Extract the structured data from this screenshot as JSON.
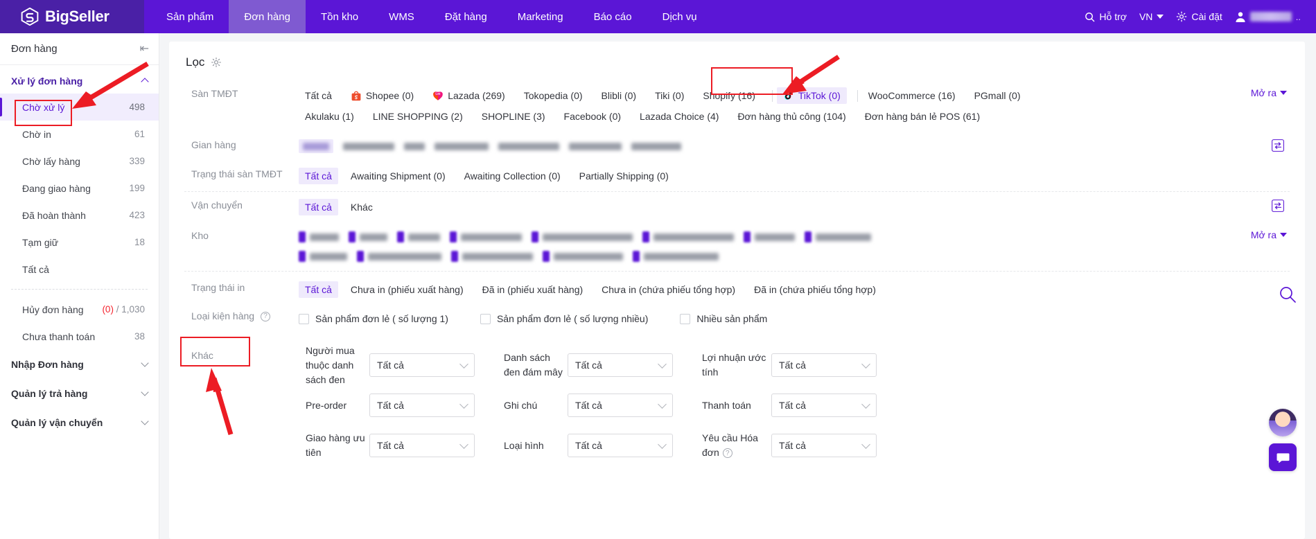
{
  "topnav": {
    "brand": "BigSeller",
    "brand_logo_icon": "bigseller-logo-icon",
    "items": [
      {
        "label": "Sản phẩm",
        "active": false
      },
      {
        "label": "Đơn hàng",
        "active": true
      },
      {
        "label": "Tồn kho",
        "active": false
      },
      {
        "label": "WMS",
        "active": false
      },
      {
        "label": "Đặt hàng",
        "active": false
      },
      {
        "label": "Marketing",
        "active": false
      },
      {
        "label": "Báo cáo",
        "active": false
      },
      {
        "label": "Dịch vụ",
        "active": false
      }
    ],
    "support": "Hỗ trợ",
    "support_icon": "search-icon",
    "language": "VN",
    "settings": "Cài đặt",
    "settings_icon": "gear-icon",
    "user_icon": "user-avatar-icon",
    "user_name_masked": ""
  },
  "sidebar": {
    "title": "Đơn hàng",
    "collapse_icon": "collapse-panel-icon",
    "group1": {
      "label": "Xử lý đơn hàng",
      "items": [
        {
          "label": "Chờ xử lý",
          "count": "498",
          "selected": true
        },
        {
          "label": "Chờ in",
          "count": "61",
          "selected": false
        },
        {
          "label": "Chờ lấy hàng",
          "count": "339",
          "selected": false
        },
        {
          "label": "Đang giao hàng",
          "count": "199",
          "selected": false
        },
        {
          "label": "Đã hoàn thành",
          "count": "423",
          "selected": false
        },
        {
          "label": "Tạm giữ",
          "count": "18",
          "selected": false
        },
        {
          "label": "Tất cả",
          "count": "",
          "selected": false
        }
      ],
      "items2": [
        {
          "label": "Hủy đơn hàng",
          "count_zero": "(0)",
          "count_rest": "/ 1,030"
        },
        {
          "label": "Chưa thanh toán",
          "count": "38"
        }
      ]
    },
    "groups": [
      {
        "label": "Nhập Đơn hàng"
      },
      {
        "label": "Quản lý trả hàng"
      },
      {
        "label": "Quản lý vận chuyển"
      }
    ]
  },
  "filter": {
    "title": "Lọc",
    "gear_icon": "gear-icon",
    "more_label": "Mở ra",
    "swap_icon": "swap-expand-icon",
    "rows": {
      "platform": {
        "label": "Sàn TMĐT",
        "line1": [
          {
            "label": "Tất cả",
            "icon": "",
            "state": "normal"
          },
          {
            "label": "Shopee (0)",
            "icon": "shopee-icon",
            "state": "normal"
          },
          {
            "label": "Lazada (269)",
            "icon": "lazada-icon",
            "state": "normal"
          },
          {
            "label": "Tokopedia (0)",
            "icon": "",
            "state": "normal"
          },
          {
            "label": "Blibli (0)",
            "icon": "",
            "state": "normal"
          },
          {
            "label": "Tiki (0)",
            "icon": "",
            "state": "normal"
          },
          {
            "label": "Shopify (16)",
            "icon": "",
            "state": "normal"
          },
          {
            "label": "TikTok (0)",
            "icon": "tiktok-icon",
            "state": "highlighted"
          },
          {
            "label": "WooCommerce (16)",
            "icon": "",
            "state": "normal"
          },
          {
            "label": "PGmall (0)",
            "icon": "",
            "state": "normal"
          }
        ],
        "line2": [
          {
            "label": "Akulaku (1)"
          },
          {
            "label": "LINE SHOPPING (2)"
          },
          {
            "label": "SHOPLINE (3)"
          },
          {
            "label": "Facebook (0)"
          },
          {
            "label": "Lazada Choice (4)"
          },
          {
            "label": "Đơn hàng thủ công (104)"
          },
          {
            "label": "Đơn hàng bán lẻ POS (61)"
          }
        ]
      },
      "shop": {
        "label": "Gian hàng",
        "masked_widths": [
          38,
          74,
          30,
          78,
          88,
          76,
          72
        ]
      },
      "platform_status": {
        "label": "Trạng thái sàn TMĐT",
        "values": [
          {
            "label": "Tất cả",
            "on": true
          },
          {
            "label": "Awaiting Shipment (0)",
            "on": false
          },
          {
            "label": "Awaiting Collection (0)",
            "on": false
          },
          {
            "label": "Partially Shipping (0)",
            "on": false
          }
        ]
      },
      "shipping": {
        "label": "Vận chuyển",
        "values": [
          {
            "label": "Tất cả",
            "on": true
          },
          {
            "label": "Khác",
            "on": false
          }
        ]
      },
      "warehouse": {
        "label": "Kho",
        "line1_widths": [
          42,
          40,
          46,
          88,
          130,
          116,
          58,
          80
        ],
        "line2_widths": [
          54,
          106,
          102,
          100,
          108
        ]
      },
      "print_status": {
        "label": "Trạng thái in",
        "values": [
          {
            "label": "Tất cả",
            "on": true
          },
          {
            "label": "Chưa in (phiếu xuất hàng)",
            "on": false
          },
          {
            "label": "Đã in (phiếu xuất hàng)",
            "on": false
          },
          {
            "label": "Chưa in (chứa phiếu tổng hợp)",
            "on": false
          },
          {
            "label": "Đã in (chứa phiếu tổng hợp)",
            "on": false
          }
        ]
      },
      "package_type": {
        "label": "Loại kiện hàng",
        "help_icon": "help-circle-icon",
        "checkboxes": [
          {
            "label": "Sản phẩm đơn lẻ ( số lượng 1)",
            "checked": false
          },
          {
            "label": "Sản phẩm đơn lẻ ( số lượng nhiều)",
            "checked": false
          },
          {
            "label": "Nhiều sản phẩm",
            "checked": false
          }
        ]
      },
      "other": {
        "label": "Khác"
      }
    },
    "fields": [
      [
        {
          "label": "Người mua thuộc danh sách đen",
          "value": "Tất cả"
        },
        {
          "label": "Pre-order",
          "value": "Tất cả"
        },
        {
          "label": "Giao hàng ưu tiên",
          "value": "Tất cả"
        }
      ],
      [
        {
          "label": "Danh sách đen đám mây",
          "value": "Tất cả"
        },
        {
          "label": "Ghi chú",
          "value": "Tất cả"
        },
        {
          "label": "Loại hình",
          "value": "Tất cả"
        }
      ],
      [
        {
          "label": "Lợi nhuận ước tính",
          "value": "Tất cả"
        },
        {
          "label": "Thanh toán",
          "value": "Tất cả"
        },
        {
          "label": "Yêu cầu Hóa đơn",
          "value": "Tất cả",
          "help_icon": "help-circle-icon"
        }
      ]
    ]
  },
  "widgets": {
    "search_icon": "search-icon",
    "avatar_icon": "assistant-avatar-icon",
    "chat_icon": "chat-bubble-icon"
  },
  "annotations": {
    "accent_red": "#ec1c24",
    "boxes": [
      "sidebar-cho-xu-ly",
      "tiktok-tab",
      "khac-label"
    ],
    "arrows": [
      "arrow-to-cho-xu-ly",
      "arrow-to-tiktok",
      "arrow-to-khac"
    ]
  },
  "colors": {
    "brand_purple": "#5b16d6",
    "nav_dark": "#4a20a6",
    "nav_active": "#7f5ad1",
    "chip_active_bg": "#efeafc",
    "danger_red": "#f5222d"
  }
}
